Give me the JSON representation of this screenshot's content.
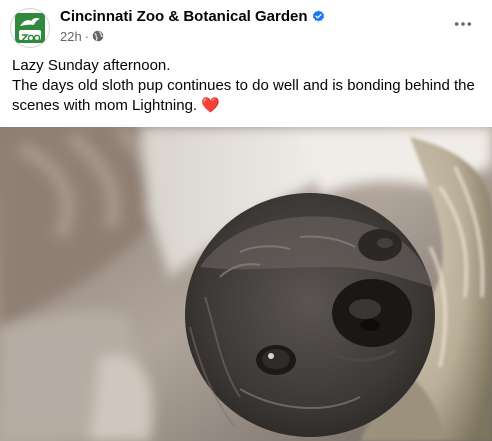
{
  "post": {
    "author": {
      "name": "Cincinnati Zoo & Botanical Garden",
      "verified_icon": "verified-badge-icon",
      "avatar_icon": "zoo-logo-icon"
    },
    "meta": {
      "timestamp": "22h",
      "separator": "·",
      "audience_icon": "globe-icon"
    },
    "menu_icon": "more-options-icon",
    "text_lines": [
      "Lazy Sunday afternoon.",
      "The days old sloth pup continues to do well and is bonding behind the scenes with mom Lightning."
    ],
    "emoji": "❤️",
    "photo": {
      "subject": "sloth-pup-photo"
    }
  },
  "colors": {
    "text_primary": "#050505",
    "text_secondary": "#65676b",
    "verified_blue": "#1877f2",
    "heart_red": "#e41e3f",
    "zoo_green": "#2f8a3e"
  }
}
